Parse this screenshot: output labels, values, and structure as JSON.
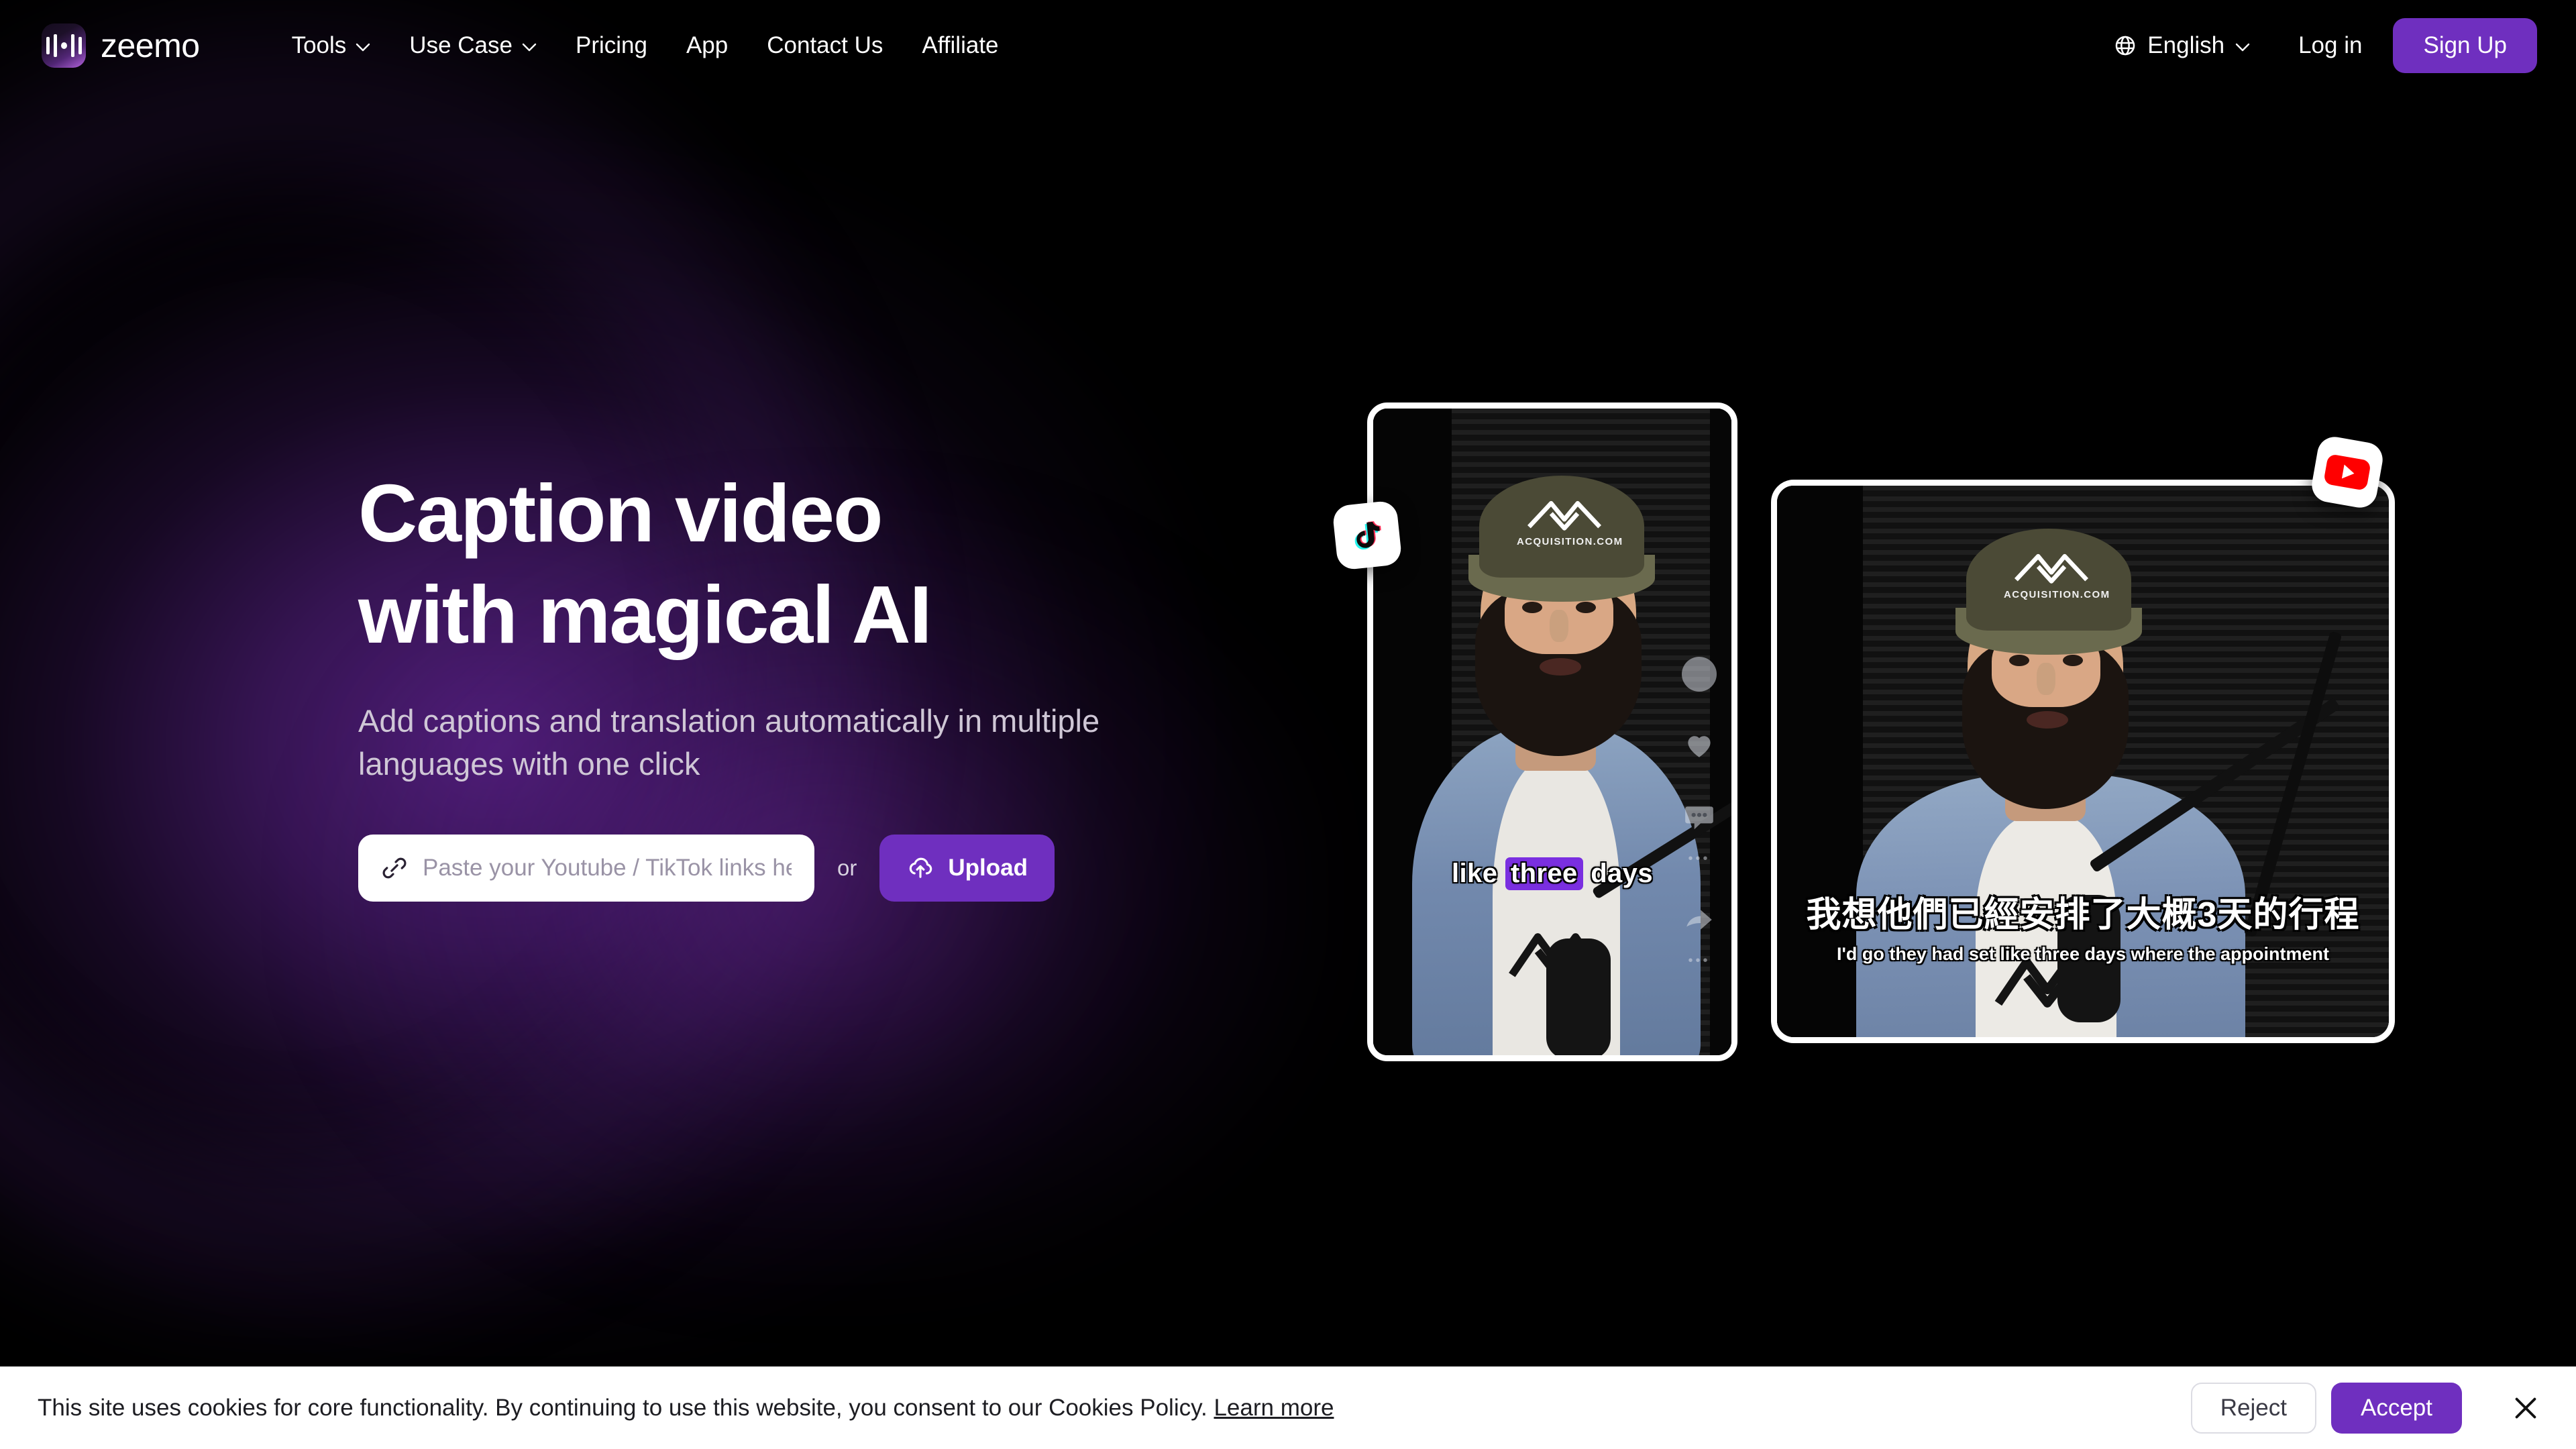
{
  "brand": {
    "name": "zeemo",
    "logo_icon": "waveform-logo-icon"
  },
  "nav": {
    "items": [
      {
        "label": "Tools",
        "has_dropdown": true
      },
      {
        "label": "Use Case",
        "has_dropdown": true
      },
      {
        "label": "Pricing",
        "has_dropdown": false
      },
      {
        "label": "App",
        "has_dropdown": false
      },
      {
        "label": "Contact Us",
        "has_dropdown": false
      },
      {
        "label": "Affiliate",
        "has_dropdown": false
      }
    ],
    "language": {
      "label": "English",
      "icon": "globe-icon"
    },
    "login_label": "Log in",
    "signup_label": "Sign Up"
  },
  "hero": {
    "title_line1": "Caption video",
    "title_line2": "with magical AI",
    "subtitle": "Add captions and translation automatically in multiple languages with one click",
    "url_placeholder": "Paste your Youtube / TikTok links here",
    "url_value": "",
    "or_label": "or",
    "upload_label": "Upload",
    "link_icon": "link-icon",
    "upload_icon": "upload-cloud-icon"
  },
  "showcase": {
    "vertical_video": {
      "platform_badge": "tiktok-icon",
      "caption_before": "like",
      "caption_highlight": "three",
      "caption_after": "days",
      "cap_logo_text": "ACQUISITION.COM",
      "social_icons": [
        "avatar-icon",
        "heart-icon",
        "comment-icon",
        "share-icon"
      ]
    },
    "wide_video": {
      "platform_badge": "youtube-icon",
      "caption_translated": "我想他們已經安排了大概3天的行程",
      "caption_original": "I'd go they had set like three days where the appointment",
      "cap_logo_text": "ACQUISITION.COM"
    }
  },
  "cookie_banner": {
    "message": "This site uses cookies for core functionality. By continuing to use this website, you consent to our Cookies Policy.",
    "learn_more": "Learn more",
    "reject_label": "Reject",
    "accept_label": "Accept",
    "close_icon": "close-icon"
  },
  "colors": {
    "accent_purple": "#6F2FBF",
    "caption_highlight": "#7A2FE0",
    "page_background": "#000000",
    "banner_background": "#FFFFFF"
  }
}
